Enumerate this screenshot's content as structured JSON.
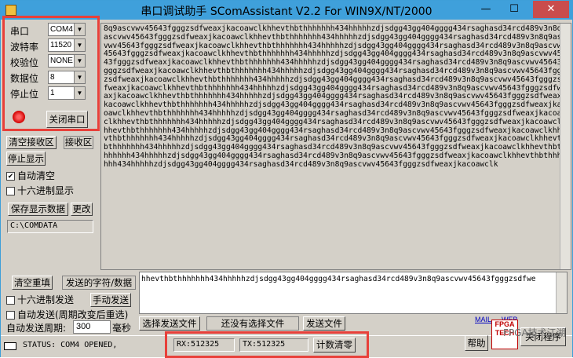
{
  "window": {
    "title": "串口调试助手 SComAssistant V2.2 For WIN9X/NT/2000"
  },
  "serial": {
    "port_label": "串口",
    "port_value": "COM4",
    "baud_label": "波特率",
    "baud_value": "11520",
    "parity_label": "校验位",
    "parity_value": "NONE",
    "databits_label": "数据位",
    "databits_value": "8",
    "stopbits_label": "停止位",
    "stopbits_value": "1",
    "close_button": "关闭串口"
  },
  "receive": {
    "clear_button": "清空接收区",
    "recv_area_label": "接收区",
    "stop_display_button": "停止显示",
    "auto_clear_label": "自动清空",
    "hex_display_label": "十六进制显示",
    "save_button": "保存显示数据",
    "change_button": "更改",
    "path_value": "C:\\COMDATA",
    "text": "8q9ascvwv45643fgggzsdfweaxjkacoawclkhhevthbthhhhhhh434hhhhhzdjsdgg43gg404gggg434rsaghasd34rcd489v3n8q9ascvwv45643fgggzsdfweaxjkacoawclkhhevthbthhhhhhh434hhhhhzdjsdgg43gg404gggg434rsaghasd34rcd489v3n8q9ascvwv45643fgggzsdfweaxjkacoawclkhhevthbthhhhhhh434hhhhhzdjsdgg43gg404gggg434rsaghasd34rcd489v3n8q9ascvwv45643fgggzsdfweaxjkacoawclkhhevthbthhhhhhh434hhhhhzdjsdgg43gg404gggg434rsaghasd34rcd489v3n8q9ascvwv45643fgggzsdfweaxjkacoawclkhhevthbthhhhhhh434hhhhhzdjsdgg43gg404gggg434rsaghasd34rcd489v3n8q9ascvwv45643fgggzsdfweaxjkacoawclkhhevthbthhhhhhh434hhhhhzdjsdgg43gg404gggg434rsaghasd34rcd489v3n8q9ascvwv45643fgggzsdfweaxjkacoawclkhhevthbthhhhhhh434hhhhhzdjsdgg43gg404gggg434rsaghasd34rcd489v3n8q9ascvwv45643fgggzsdfweaxjkacoawclkhhevthbthhhhhhh434hhhhhzdjsdgg43gg404gggg434rsaghasd34rcd489v3n8q9ascvwv45643fgggzsdfweaxjkacoawclkhhevthbthhhhhhh434hhhhhzdjsdgg43gg404gggg434rsaghasd34rcd489v3n8q9ascvwv45643fgggzsdfweaxjkacoawclkhhevthbthhhhhhh434hhhhhzdjsdgg43gg404gggg434rsaghasd34rcd489v3n8q9ascvwv45643fgggzsdfweaxjkacoawclkhhevthbthhhhhhh434hhhhhzdjsdgg43gg404gggg434rsaghasd34rcd489v3n8q9ascvwv45643fgggzsdfweaxjkacoawclkhhevthbthhhhhhh434hhhhhzdjsdgg43gg404gggg434rsaghasd34rcd489v3n8q9ascvwv45643fgggzsdfweaxjkacoawclkhhevthbthhhhhhh434hhhhhzdjsdgg43gg404gggg434rsaghasd34rcd489v3n8q9ascvwv45643fgggzsdfweaxjkacoawclkhhevthbthhhhhhh434hhhhhzdjsdgg43gg404gggg434rsaghasd34rcd489v3n8q9ascvwv45643fgggzsdfweaxjkacoawclkhhevthbthhhhhhh434hhhhhzdjsdgg43gg404gggg434rsaghasd34rcd489v3n8q9ascvwv45643fgggzsdfweaxjkacoawclkhhevthbthhhhhhh434hhhhhzdjsdgg43gg404gggg434rsaghasd34rcd489v3n8q9ascvwv45643fgggzsdfweaxjkacoawclkhhevthbthhhhhhh434hhhhhzdjsdgg43gg404gggg434rsaghasd34rcd489v3n8q9ascvwv45643fgggzsdfweaxjkacoawclk"
  },
  "send": {
    "clear_reinput_button": "清空重填",
    "send_chars_label": "发送的字符/数据",
    "hex_send_label": "十六进制发送",
    "manual_send_button": "手动发送",
    "auto_send_label": "自动发送(周期改变后重选)",
    "period_label": "自动发送周期:",
    "period_value": "300",
    "period_unit": "毫秒",
    "text": "hhevthbthhhhhhh434hhhhhzdjsdgg43gg404gggg434rsaghasd34rcd489v3n8q9ascvwv45643fgggzsdfwe",
    "choose_file_button": "选择发送文件",
    "no_file_label": "还没有选择文件",
    "send_file_button": "发送文件"
  },
  "links": {
    "mail": "MAIL",
    "web": "WEB"
  },
  "status": {
    "status_text": "STATUS: COM4 OPENED,",
    "rx_text": "RX:512325",
    "tx_text": "TX:512325",
    "reset_count_button": "计数清零",
    "help_button": "帮助",
    "exit_button": "关闭程序"
  },
  "watermark": {
    "text": "FPGA技术江湖"
  },
  "colors": {
    "title_bg": "#3fa0db",
    "highlight": "#e8403a",
    "window_bg": "#d4d0c8"
  }
}
